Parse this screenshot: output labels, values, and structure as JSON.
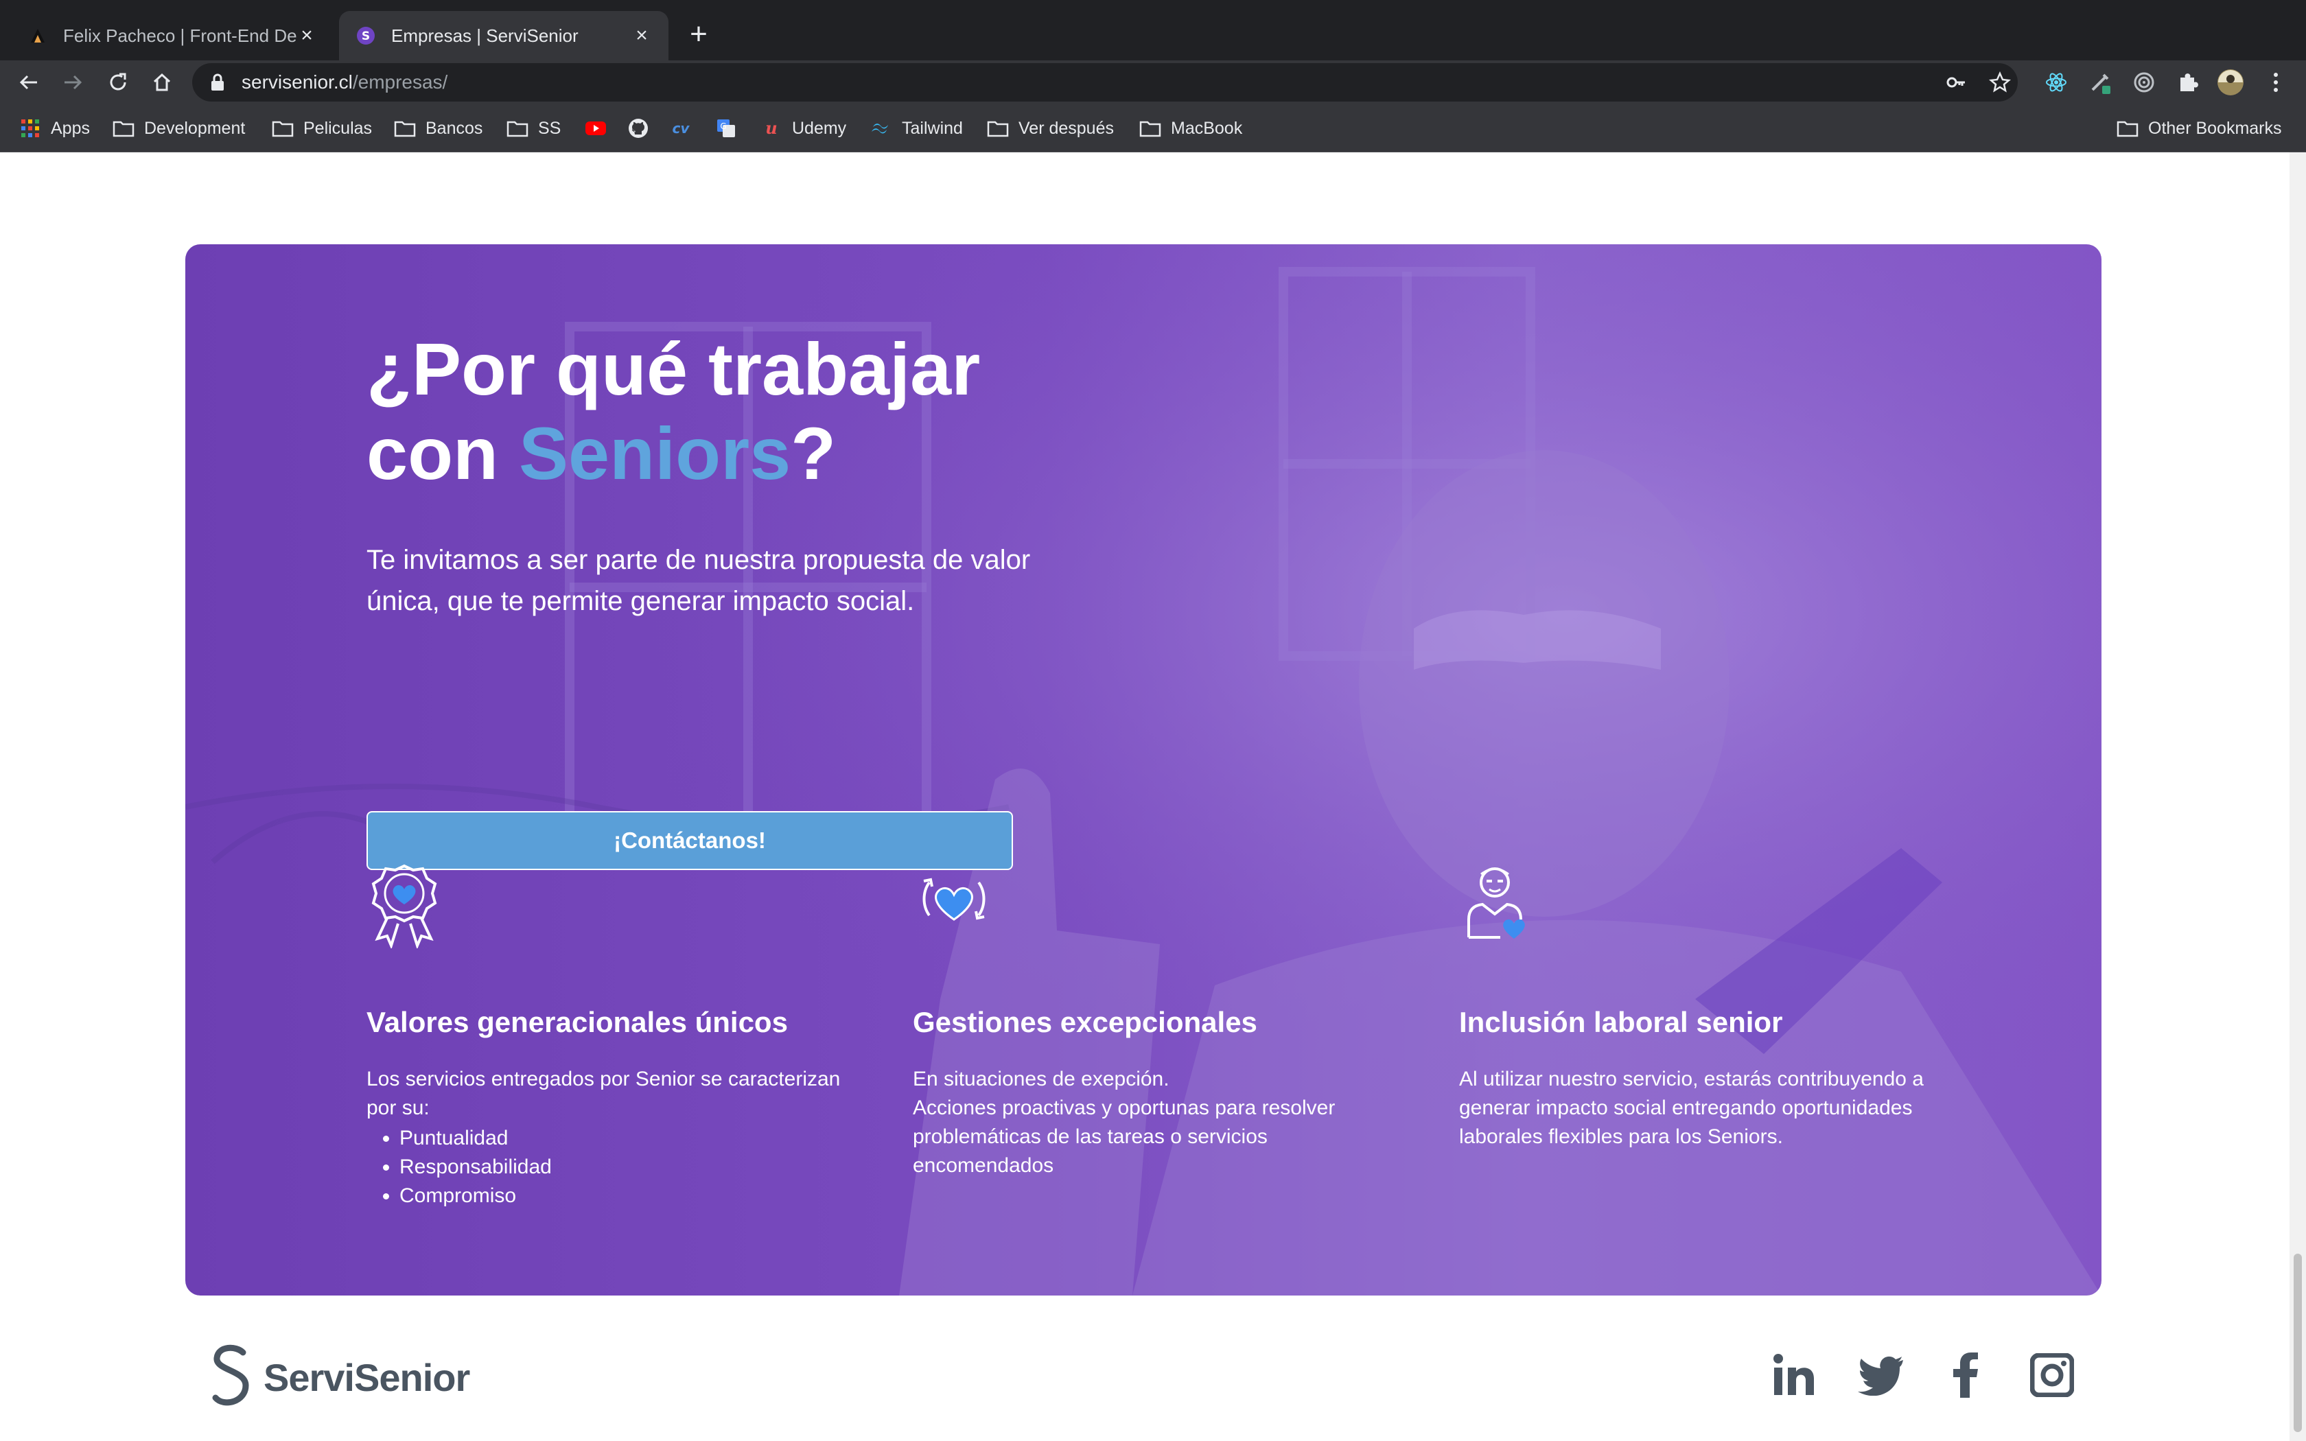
{
  "browser": {
    "tabs": [
      {
        "title": "Felix Pacheco | Front-End Developer",
        "active": false
      },
      {
        "title": "Empresas | ServiSenior",
        "active": true
      }
    ],
    "url_host": "servisenior.cl",
    "url_path": "/empresas/",
    "bookmarks": {
      "apps": "Apps",
      "development": "Development",
      "peliculas": "Peliculas",
      "bancos": "Bancos",
      "ss": "SS",
      "udemy": "Udemy",
      "tailwind": "Tailwind",
      "ver_despues": "Ver después",
      "macbook": "MacBook",
      "other": "Other Bookmarks"
    }
  },
  "hero": {
    "title_line1": "¿Por qué trabajar",
    "title_line2_pre": "con ",
    "title_accent": "Seniors",
    "title_line2_post": "?",
    "text": "Te invitamos a ser parte de nuestra propuesta de valor única, que te permite generar impacto social.",
    "cta_label": "¡Contáctanos!"
  },
  "features": [
    {
      "title": "Valores generacionales únicos",
      "text": "Los servicios entregados por Senior se caracterizan por su:",
      "list": [
        "Puntualidad",
        "Responsabilidad",
        "Compromiso"
      ]
    },
    {
      "title": "Gestiones excepcionales",
      "text_line1": "En situaciones de exepción.",
      "text_line2": "Acciones proactivas y oportunas para resolver problemáticas de las tareas o servicios encomendados"
    },
    {
      "title": "Inclusión laboral senior",
      "text": "Al utilizar nuestro servicio, estarás contribuyendo a generar impacto social entregando oportunidades laborales flexibles para los Seniors."
    }
  ],
  "footer": {
    "logo_text": "ServiSenior"
  },
  "colors": {
    "accent_blue": "#5fa4dd",
    "purple": "#7a4cc0",
    "heart_blue": "#3d8ef0"
  }
}
